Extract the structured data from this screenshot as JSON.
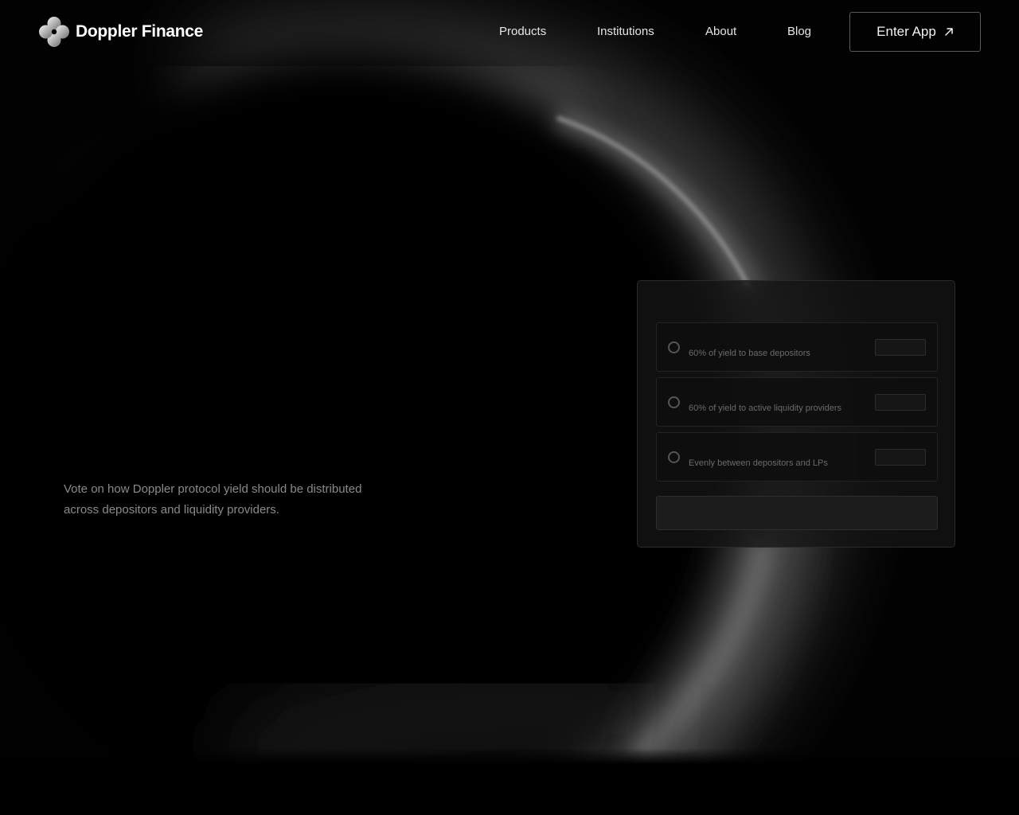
{
  "header": {
    "brand": "Doppler Finance",
    "logo_icon": "doppler-petal-logo-icon",
    "nav": [
      "Products",
      "Institutions",
      "About",
      "Blog"
    ],
    "cta_label": "Enter App",
    "cta_icon": "arrow-up-right-icon"
  },
  "hero": {
    "description": "Vote on how Doppler protocol yield should be distributed across depositors and liquidity providers."
  },
  "vote_card": {
    "options": [
      {
        "label": "60% of yield to base depositors"
      },
      {
        "label": "60% of yield to active liquidity providers"
      },
      {
        "label": "Evenly between depositors and LPs"
      }
    ]
  },
  "colors": {
    "background": "#000000",
    "text": "#ffffff",
    "muted_text": "#8a8a8a",
    "button_border": "#5a5a5a"
  }
}
